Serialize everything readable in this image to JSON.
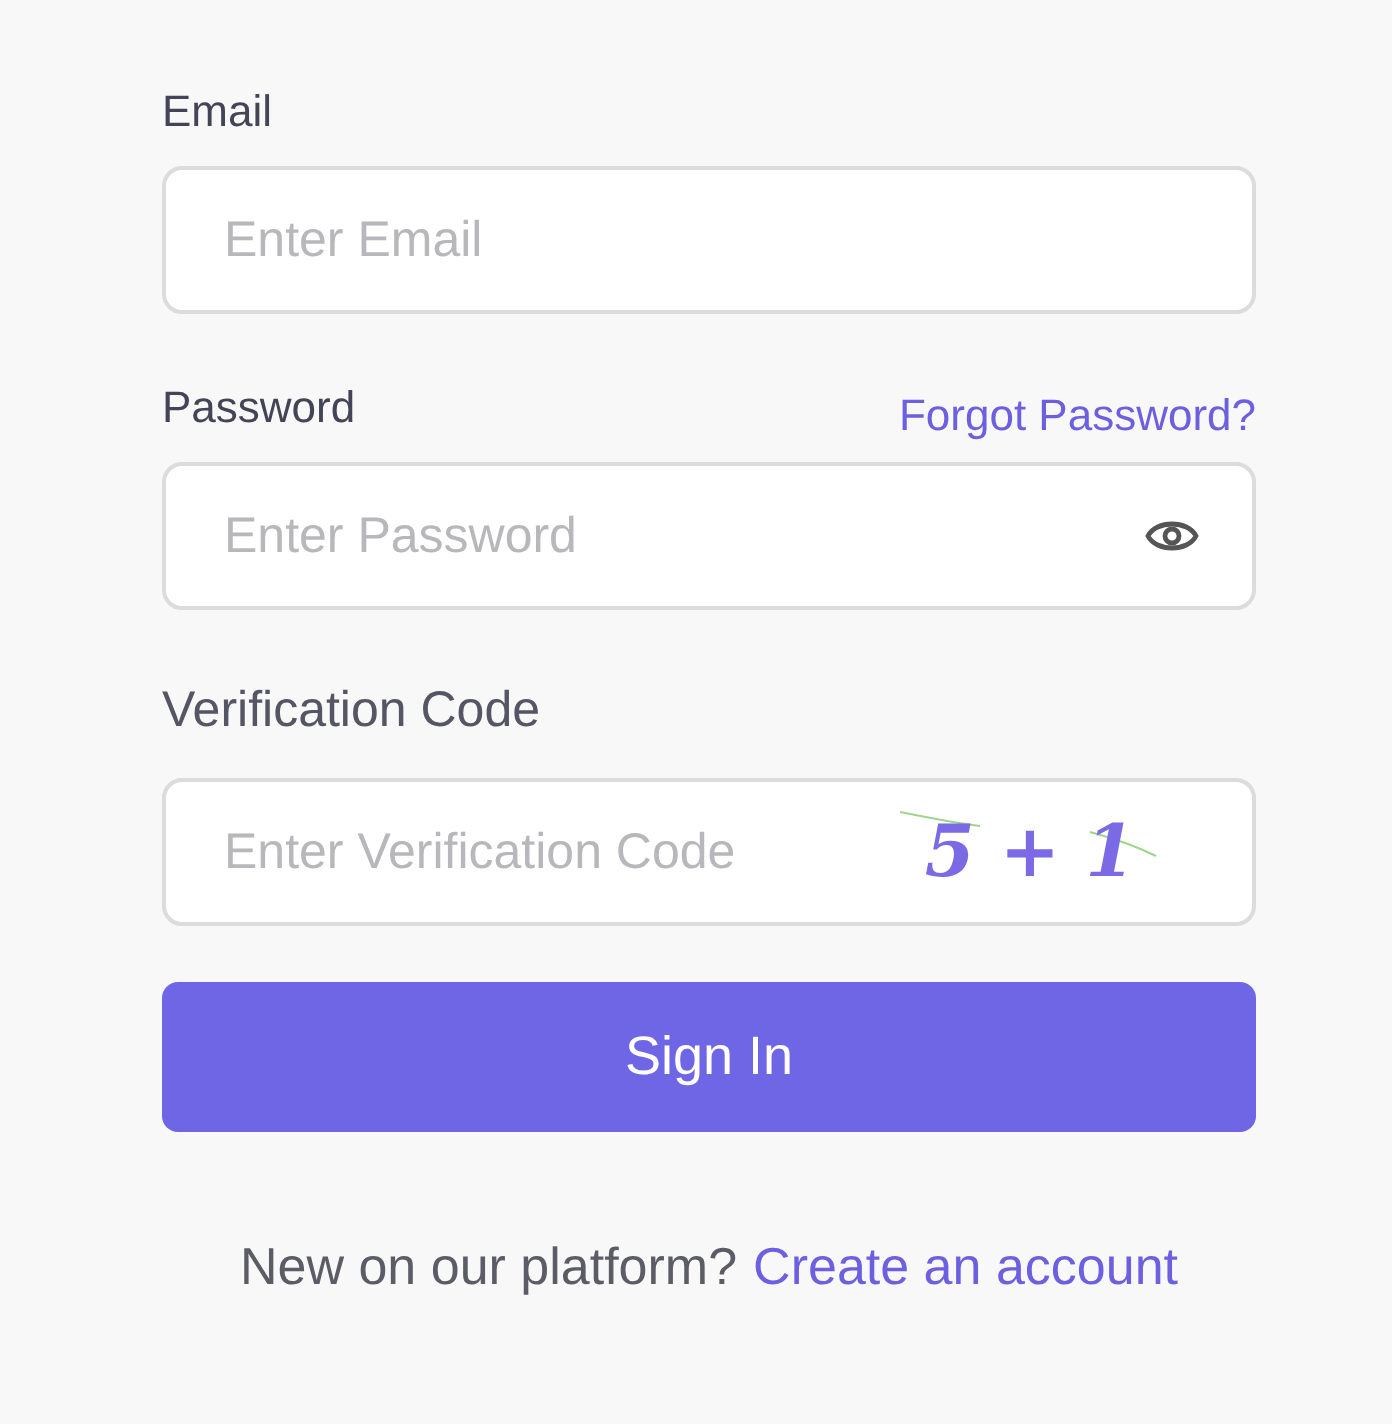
{
  "email": {
    "label": "Email",
    "placeholder": "Enter Email"
  },
  "password": {
    "label": "Password",
    "forgot_link": "Forgot Password?",
    "placeholder": "Enter Password"
  },
  "verification": {
    "label": "Verification Code",
    "placeholder": "Enter Verification Code",
    "captcha": "5 + 1"
  },
  "sign_in_button": "Sign In",
  "footer": {
    "text": "New on our platform?",
    "link": "Create an account"
  }
}
